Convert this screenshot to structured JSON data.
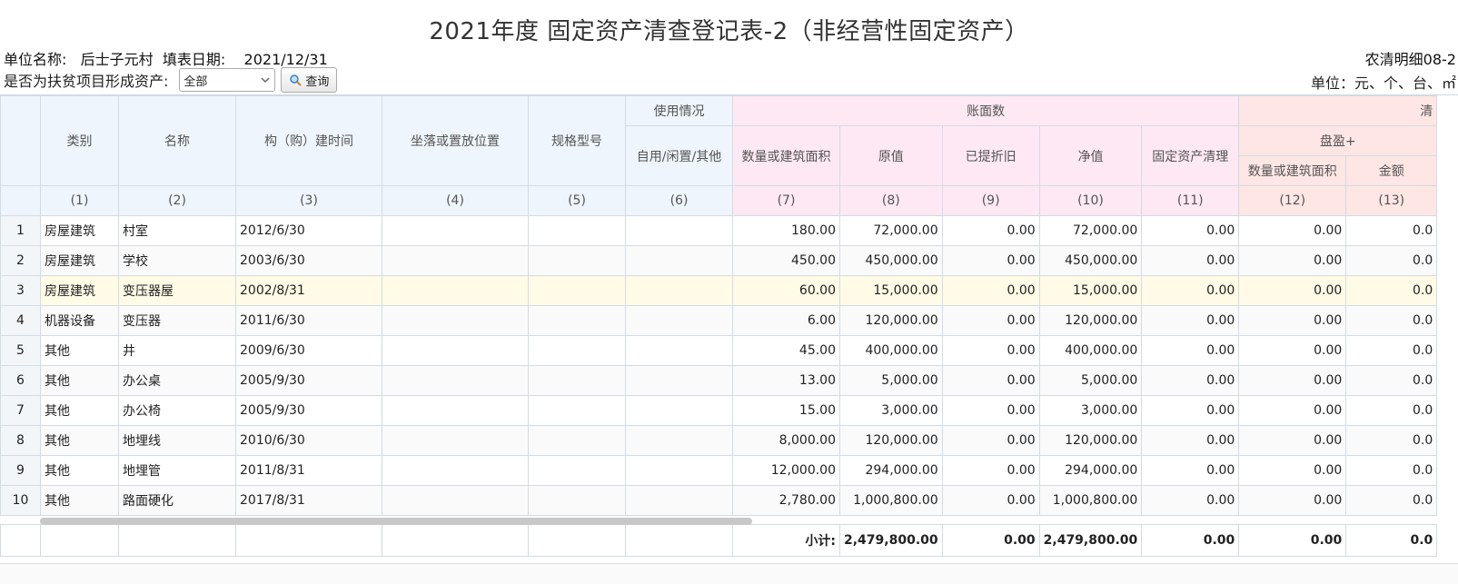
{
  "page": {
    "title": "2021年度 固定资产清查登记表-2（非经营性固定资产）",
    "info_left": "单位名称:   后士子元村  填表日期:    2021/12/31",
    "info_right": "农清明细08-2",
    "filter_label": "是否为扶贫项目形成资产:",
    "filter_value": "全部",
    "query_label": "查询",
    "unit_label": "单位：元、个、台、㎡"
  },
  "headers": {
    "category": "类别",
    "name": "名称",
    "build_time": "构（购）建时间",
    "location": "坐落或置放位置",
    "spec": "规格型号",
    "usage_group": "使用情况",
    "usage": "自用/闲置/其他",
    "book_group": "账面数",
    "qty": "数量或建筑面积",
    "orig": "原值",
    "dep": "已提折旧",
    "net": "净值",
    "clear": "固定资产清理",
    "check_group": "清",
    "surplus_group": "盘盈+",
    "surplus_qty": "数量或建筑面积",
    "surplus_amt": "金额"
  },
  "col_nums": [
    "(1)",
    "(2)",
    "(3)",
    "(4)",
    "(5)",
    "(6)",
    "(7)",
    "(8)",
    "(9)",
    "(10)",
    "(11)",
    "(12)",
    "(13)"
  ],
  "rows": [
    {
      "n": "1",
      "cat": "房屋建筑",
      "name": "村室",
      "date": "2012/6/30",
      "qty": "180.00",
      "orig": "72,000.00",
      "dep": "0.00",
      "net": "72,000.00",
      "clear": "0.00",
      "sq": "0.00",
      "sa": "0.0"
    },
    {
      "n": "2",
      "cat": "房屋建筑",
      "name": "学校",
      "date": "2003/6/30",
      "qty": "450.00",
      "orig": "450,000.00",
      "dep": "0.00",
      "net": "450,000.00",
      "clear": "0.00",
      "sq": "0.00",
      "sa": "0.0"
    },
    {
      "n": "3",
      "cat": "房屋建筑",
      "name": "变压器屋",
      "date": "2002/8/31",
      "qty": "60.00",
      "orig": "15,000.00",
      "dep": "0.00",
      "net": "15,000.00",
      "clear": "0.00",
      "sq": "0.00",
      "sa": "0.0"
    },
    {
      "n": "4",
      "cat": "机器设备",
      "name": "变压器",
      "date": "2011/6/30",
      "qty": "6.00",
      "orig": "120,000.00",
      "dep": "0.00",
      "net": "120,000.00",
      "clear": "0.00",
      "sq": "0.00",
      "sa": "0.0"
    },
    {
      "n": "5",
      "cat": "其他",
      "name": "井",
      "date": "2009/6/30",
      "qty": "45.00",
      "orig": "400,000.00",
      "dep": "0.00",
      "net": "400,000.00",
      "clear": "0.00",
      "sq": "0.00",
      "sa": "0.0"
    },
    {
      "n": "6",
      "cat": "其他",
      "name": "办公桌",
      "date": "2005/9/30",
      "qty": "13.00",
      "orig": "5,000.00",
      "dep": "0.00",
      "net": "5,000.00",
      "clear": "0.00",
      "sq": "0.00",
      "sa": "0.0"
    },
    {
      "n": "7",
      "cat": "其他",
      "name": "办公椅",
      "date": "2005/9/30",
      "qty": "15.00",
      "orig": "3,000.00",
      "dep": "0.00",
      "net": "3,000.00",
      "clear": "0.00",
      "sq": "0.00",
      "sa": "0.0"
    },
    {
      "n": "8",
      "cat": "其他",
      "name": "地埋线",
      "date": "2010/6/30",
      "qty": "8,000.00",
      "orig": "120,000.00",
      "dep": "0.00",
      "net": "120,000.00",
      "clear": "0.00",
      "sq": "0.00",
      "sa": "0.0"
    },
    {
      "n": "9",
      "cat": "其他",
      "name": "地埋管",
      "date": "2011/8/31",
      "qty": "12,000.00",
      "orig": "294,000.00",
      "dep": "0.00",
      "net": "294,000.00",
      "clear": "0.00",
      "sq": "0.00",
      "sa": "0.0"
    },
    {
      "n": "10",
      "cat": "其他",
      "name": "路面硬化",
      "date": "2017/8/31",
      "qty": "2,780.00",
      "orig": "1,000,800.00",
      "dep": "0.00",
      "net": "1,000,800.00",
      "clear": "0.00",
      "sq": "0.00",
      "sa": "0.0"
    }
  ],
  "footer": {
    "label": "小计:",
    "orig": "2,479,800.00",
    "dep": "0.00",
    "net": "2,479,800.00",
    "clear": "0.00",
    "sq": "0.00",
    "sa": "0.0"
  },
  "icons": {
    "query": "magnifier-icon",
    "select": "chevron-down-icon"
  }
}
